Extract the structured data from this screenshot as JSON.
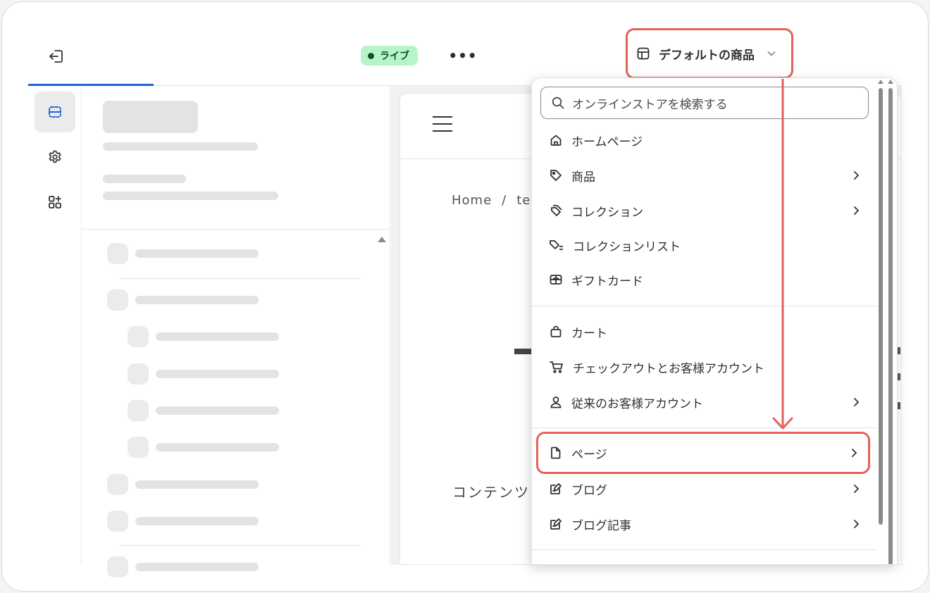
{
  "header": {
    "live_badge": "ライブ",
    "more_label": "•••",
    "template_selector": "デフォルトの商品"
  },
  "preview": {
    "breadcrumb_home": "Home",
    "breadcrumb_sep": "/",
    "breadcrumb_current": "te",
    "content_text": "コンテンツ"
  },
  "dropdown": {
    "search_placeholder": "オンラインストアを検索する",
    "groups": [
      [
        {
          "label": "ホームページ",
          "icon": "home-icon",
          "has_arrow": false
        },
        {
          "label": "商品",
          "icon": "tag-icon",
          "has_arrow": true
        },
        {
          "label": "コレクション",
          "icon": "collection-icon",
          "has_arrow": true
        },
        {
          "label": "コレクションリスト",
          "icon": "collection-list-icon",
          "has_arrow": false
        },
        {
          "label": "ギフトカード",
          "icon": "gift-card-icon",
          "has_arrow": false
        }
      ],
      [
        {
          "label": "カート",
          "icon": "bag-icon",
          "has_arrow": false
        },
        {
          "label": "チェックアウトとお客様アカウント",
          "icon": "cart-icon",
          "has_arrow": false
        },
        {
          "label": "従来のお客様アカウント",
          "icon": "person-icon",
          "has_arrow": true
        }
      ],
      [
        {
          "label": "ページ",
          "icon": "page-icon",
          "has_arrow": true,
          "highlighted": true
        },
        {
          "label": "ブログ",
          "icon": "blog-icon",
          "has_arrow": true
        },
        {
          "label": "ブログ記事",
          "icon": "blog-post-icon",
          "has_arrow": true
        }
      ]
    ]
  },
  "annotation_color": "#e4615a",
  "accent_color": "#1f63d4"
}
